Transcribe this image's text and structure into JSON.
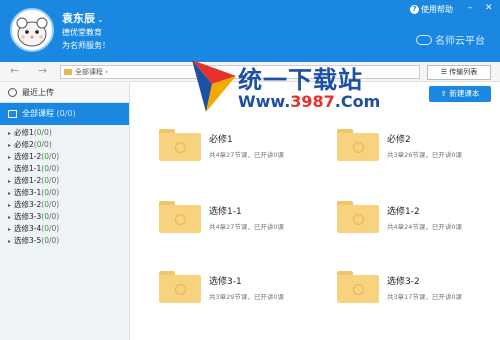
{
  "header": {
    "user_name": "袁东辰",
    "name_caret": "⌄",
    "org": "德优堂教育",
    "slogan": "为名师服务！",
    "help_label": "使用帮助",
    "help_glyph": "?",
    "minimize_glyph": "–",
    "close_glyph": "✕",
    "brand": "名师云平台",
    "bg_color": "#1a88e0"
  },
  "toolbar": {
    "back_glyph": "←",
    "forward_glyph": "→",
    "address": "全部课程 ›",
    "upload_list_label": "传输列表"
  },
  "sidebar": {
    "recent_label": "最近上传",
    "all_courses_label": "全部课程",
    "all_courses_count": "(0/0)",
    "items": [
      {
        "label": "必修1",
        "count_open": "(",
        "count_num": "0",
        "count_close": "/0)"
      },
      {
        "label": "必修2",
        "count_open": "(",
        "count_num": "0",
        "count_close": "/0)"
      },
      {
        "label": "选修1-2",
        "count_open": "(",
        "count_num": "0",
        "count_close": "/0)"
      },
      {
        "label": "选修1-1",
        "count_open": "(",
        "count_num": "0",
        "count_close": "/0)"
      },
      {
        "label": "选修1-2",
        "count_open": "(",
        "count_num": "0",
        "count_close": "/0)"
      },
      {
        "label": "选修3-1",
        "count_open": "(",
        "count_num": "0",
        "count_close": "/0)"
      },
      {
        "label": "选修3-2",
        "count_open": "(",
        "count_num": "0",
        "count_close": "/0)"
      },
      {
        "label": "选修3-3",
        "count_open": "(",
        "count_num": "0",
        "count_close": "/0)"
      },
      {
        "label": "选修3-4",
        "count_open": "(",
        "count_num": "0",
        "count_close": "/0)"
      },
      {
        "label": "选修3-5",
        "count_open": "(",
        "count_num": "0",
        "count_close": "/0)"
      }
    ]
  },
  "main": {
    "new_course_label": "新建课本",
    "new_course_glyph": "⇪",
    "courses": [
      {
        "title": "必修1",
        "meta": "共4章27节课，已开讲0课"
      },
      {
        "title": "必修2",
        "meta": "共3章26节课，已开讲0课"
      },
      {
        "title": "选修1-1",
        "meta": "共4章27节课，已开讲0课"
      },
      {
        "title": "选修1-2",
        "meta": "共4章24节课，已开讲0课"
      },
      {
        "title": "选修3-1",
        "meta": "共3章29节课，已开讲0课"
      },
      {
        "title": "选修3-2",
        "meta": "共3章17节课，已开讲0课"
      }
    ]
  },
  "watermark": {
    "text": "统一下载站",
    "url_prefix": "Www.",
    "url_num": "3987",
    "url_suffix": ".Com"
  },
  "icons": {
    "recent": "clock-icon",
    "all_courses": "folder-icon",
    "course": "folder-play-icon",
    "upload_list": "list-icon"
  }
}
